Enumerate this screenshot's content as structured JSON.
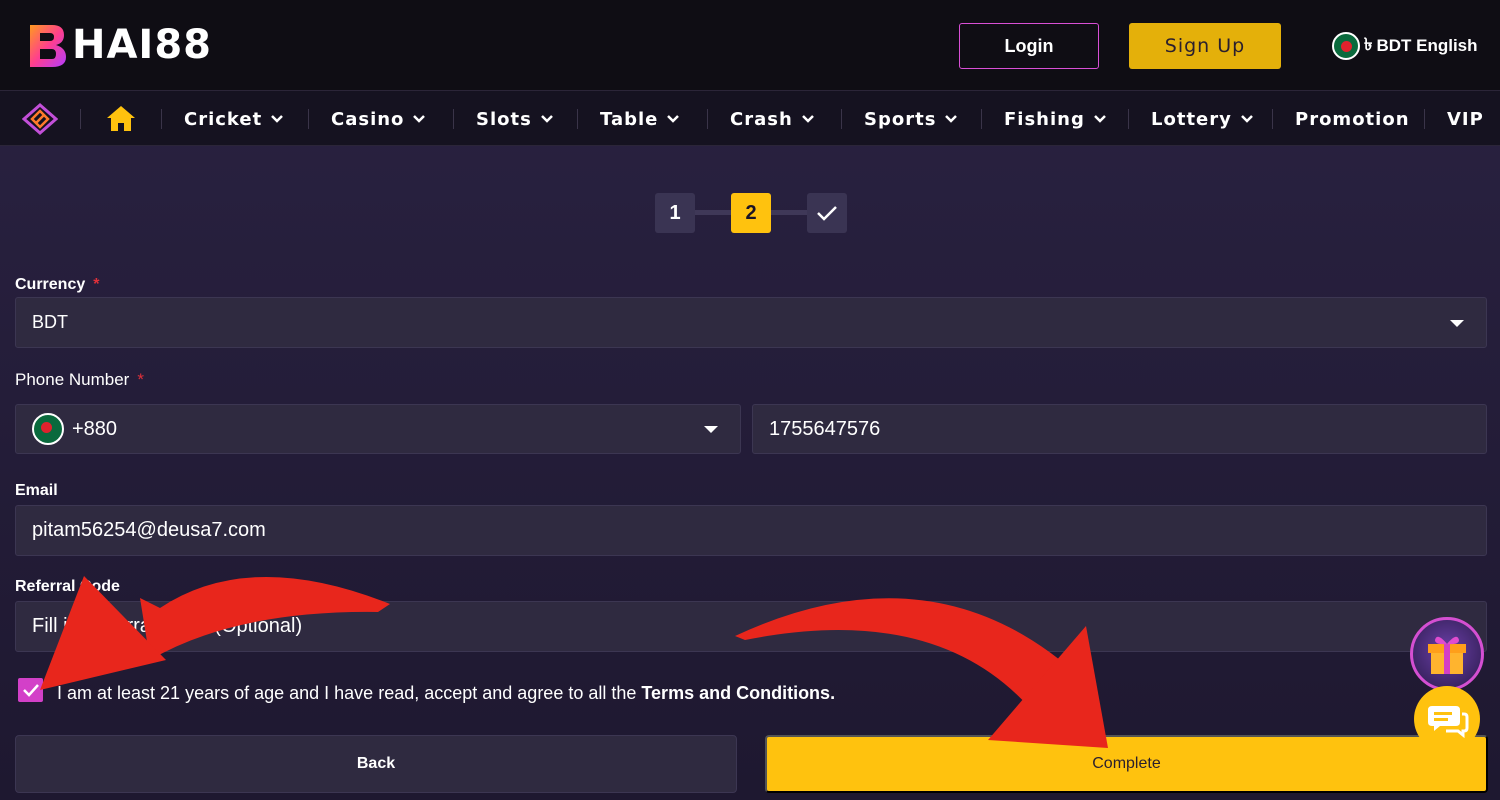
{
  "header": {
    "logo_text": "HAI88",
    "login_label": "Login",
    "signup_label": "Sign Up",
    "currency_symbol": "৳",
    "language_label": "BDT English"
  },
  "nav": {
    "items": [
      {
        "label": "Cricket",
        "dropdown": true
      },
      {
        "label": "Casino",
        "dropdown": true
      },
      {
        "label": "Slots",
        "dropdown": true
      },
      {
        "label": "Table",
        "dropdown": true
      },
      {
        "label": "Crash",
        "dropdown": true
      },
      {
        "label": "Sports",
        "dropdown": true
      },
      {
        "label": "Fishing",
        "dropdown": true
      },
      {
        "label": "Lottery",
        "dropdown": true
      },
      {
        "label": "Promotion",
        "dropdown": false
      },
      {
        "label": "VIP",
        "dropdown": false
      }
    ]
  },
  "stepper": {
    "step1": "1",
    "step2": "2",
    "current_step": 2,
    "final_icon": "checkmark-icon"
  },
  "form": {
    "currency_label": "Currency",
    "required_mark": "*",
    "currency_value": "BDT",
    "phone_label": "Phone Number",
    "country_code": "+880",
    "phone_value": "1755647576",
    "email_label": "Email",
    "email_value": "pitam56254@deusa7.com",
    "referral_label": "Referral Code",
    "referral_placeholder": "Fill in Referral Code (Optional)",
    "agree_checked": true,
    "agree_text": "I am at least 21 years of age and I have read, accept and agree to all the ",
    "terms_link": "Terms and Conditions."
  },
  "actions": {
    "back_label": "Back",
    "complete_label": "Complete"
  },
  "colors": {
    "accent_yellow": "#ffc20e",
    "accent_pink": "#d340c8",
    "annotation_red": "#e8261c"
  }
}
